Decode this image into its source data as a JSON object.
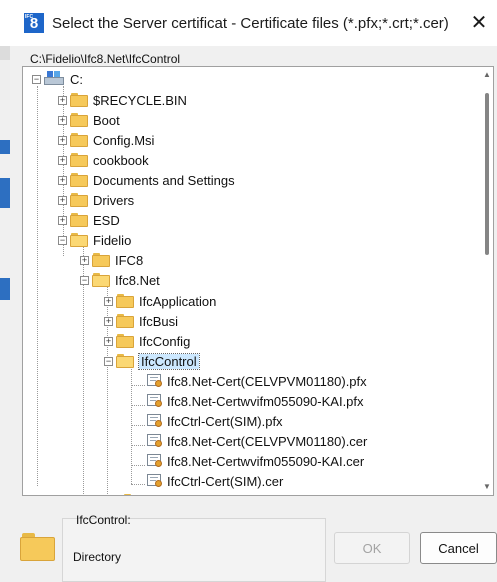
{
  "window": {
    "title": "Select the Server certificat - Certificate files (*.pfx;*.crt;*.cer)",
    "app_icon_text": "8",
    "app_icon_prefix": "IFC",
    "close_glyph": "✕"
  },
  "path": "C:\\Fidelio\\Ifc8.Net\\IfcControl",
  "tree": {
    "root": "C:",
    "items": [
      {
        "label": "$RECYCLE.BIN",
        "kind": "folder",
        "expander": "+"
      },
      {
        "label": "Boot",
        "kind": "folder",
        "expander": "+"
      },
      {
        "label": "Config.Msi",
        "kind": "folder",
        "expander": "+"
      },
      {
        "label": "cookbook",
        "kind": "folder",
        "expander": "+"
      },
      {
        "label": "Documents and Settings",
        "kind": "folder",
        "expander": "+"
      },
      {
        "label": "Drivers",
        "kind": "folder",
        "expander": "+"
      },
      {
        "label": "ESD",
        "kind": "folder",
        "expander": "+"
      },
      {
        "label": "Fidelio",
        "kind": "folder",
        "expander": "−"
      },
      {
        "label": "IFC8",
        "kind": "folder",
        "expander": "+"
      },
      {
        "label": "Ifc8.Net",
        "kind": "folder",
        "expander": "−"
      },
      {
        "label": "IfcApplication",
        "kind": "folder",
        "expander": "+"
      },
      {
        "label": "IfcBusi",
        "kind": "folder",
        "expander": "+"
      },
      {
        "label": "IfcConfig",
        "kind": "folder",
        "expander": "+"
      },
      {
        "label": "IfcControl",
        "kind": "folder",
        "expander": "−"
      },
      {
        "label": "Ifc8.Net-Cert(CELVPVM01180).pfx",
        "kind": "file"
      },
      {
        "label": "Ifc8.Net-Certwvifm055090-KAI.pfx",
        "kind": "file"
      },
      {
        "label": "IfcCtrl-Cert(SIM).pfx",
        "kind": "file"
      },
      {
        "label": "Ifc8.Net-Cert(CELVPVM01180).cer",
        "kind": "file"
      },
      {
        "label": "Ifc8.Net-Certwvifm055090-KAI.cer",
        "kind": "file"
      },
      {
        "label": "IfcCtrl-Cert(SIM).cer",
        "kind": "file"
      }
    ]
  },
  "selection": {
    "name": "IfcControl:",
    "type": "Directory"
  },
  "buttons": {
    "ok": "OK",
    "cancel": "Cancel"
  },
  "colors": {
    "folder": "#f6c95a",
    "selection_highlight": "#cce8ff",
    "app_icon": "#1e66c9"
  }
}
